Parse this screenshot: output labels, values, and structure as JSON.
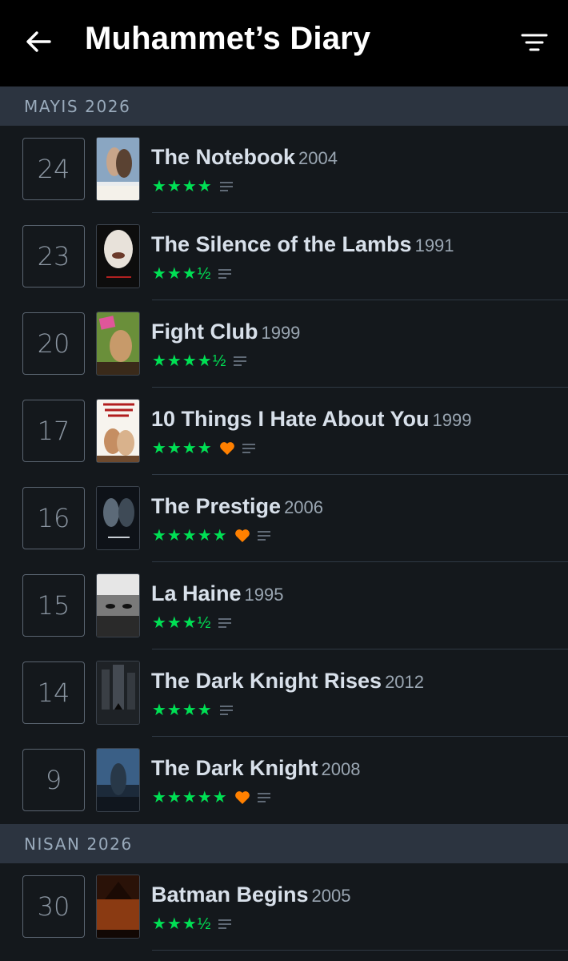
{
  "header": {
    "title": "Muhammet’s Diary"
  },
  "sections": [
    {
      "month": "MAYIS 2026",
      "entries": [
        {
          "day": "24",
          "title": "The Notebook",
          "year": "2004",
          "rating": "★★★★",
          "liked": false,
          "poster_text": "NOTEBOOK"
        },
        {
          "day": "23",
          "title": "The Silence of the Lambs",
          "year": "1991",
          "rating": "★★★½",
          "liked": false,
          "poster_text": ""
        },
        {
          "day": "20",
          "title": "Fight Club",
          "year": "1999",
          "rating": "★★★★½",
          "liked": false,
          "poster_text": ""
        },
        {
          "day": "17",
          "title": "10 Things I Hate About You",
          "year": "1999",
          "rating": "★★★★",
          "liked": true,
          "poster_text": "10 things I hate about you"
        },
        {
          "day": "16",
          "title": "The Prestige",
          "year": "2006",
          "rating": "★★★★★",
          "liked": true,
          "poster_text": "THE PRESTIGE"
        },
        {
          "day": "15",
          "title": "La Haine",
          "year": "1995",
          "rating": "★★★½",
          "liked": false,
          "poster_text": "LA HAINE"
        },
        {
          "day": "14",
          "title": "The Dark Knight Rises",
          "year": "2012",
          "rating": "★★★★",
          "liked": false,
          "poster_text": ""
        },
        {
          "day": "9",
          "title": "The Dark Knight",
          "year": "2008",
          "rating": "★★★★★",
          "liked": true,
          "poster_text": ""
        }
      ]
    },
    {
      "month": "NISAN 2026",
      "entries": [
        {
          "day": "30",
          "title": "Batman Begins",
          "year": "2005",
          "rating": "★★★½",
          "liked": false,
          "poster_text": ""
        }
      ]
    }
  ],
  "colors": {
    "star_green": "#00e054",
    "heart_orange": "#ff8000",
    "background": "#14181c",
    "section_bar": "#2c3440"
  },
  "icons": {
    "back": "arrow-left-icon",
    "filter": "filter-icon",
    "liked": "heart-icon",
    "review": "review-lines-icon"
  }
}
